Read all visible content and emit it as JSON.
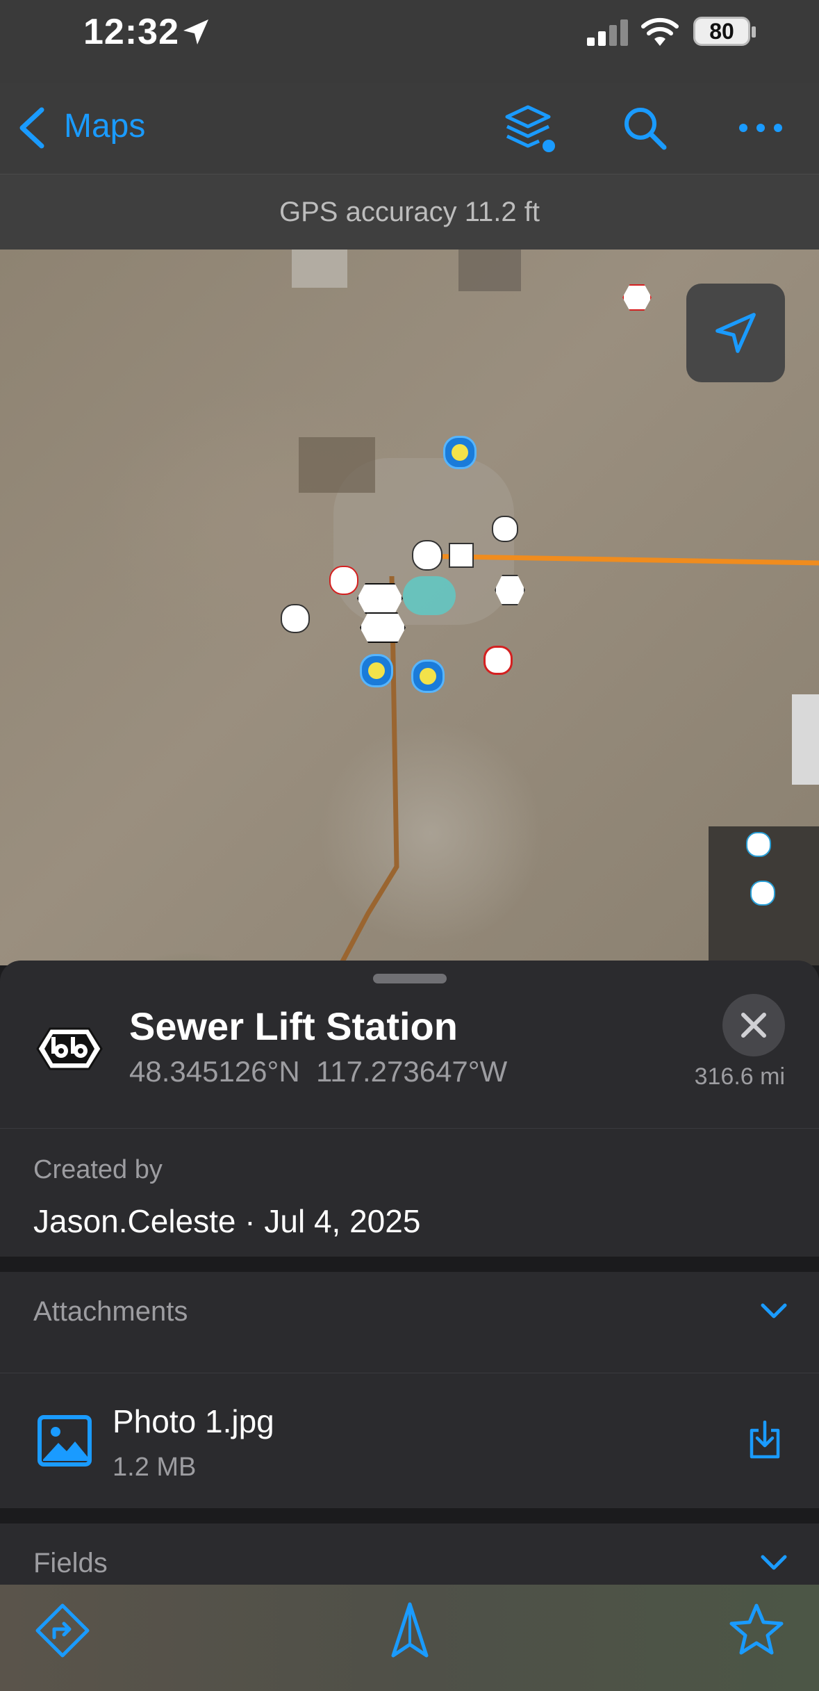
{
  "status_bar": {
    "time": "12:32",
    "battery": "80"
  },
  "nav": {
    "back_label": "Maps"
  },
  "gps": {
    "accuracy_text": "GPS accuracy 11.2 ft"
  },
  "feature": {
    "title": "Sewer Lift Station",
    "latitude": "48.345126°N",
    "longitude": "117.273647°W",
    "distance": "316.6 mi"
  },
  "created": {
    "label": "Created by",
    "value": "Jason.Celeste · Jul 4, 2025"
  },
  "attachments": {
    "label": "Attachments",
    "items": [
      {
        "name": "Photo 1.jpg",
        "size": "1.2 MB"
      }
    ]
  },
  "fields": {
    "label": "Fields"
  },
  "colors": {
    "accent": "#1a9bff",
    "sheet_bg": "#2b2b2e",
    "line_orange": "#f08c1e",
    "line_brown": "#9a6530"
  },
  "icons": {
    "status": [
      "location-arrow-icon",
      "signal-icon",
      "wifi-icon",
      "battery-icon"
    ],
    "nav": [
      "chevron-left-icon",
      "layers-icon",
      "search-icon",
      "more-icon"
    ],
    "map": [
      "recenter-arrow-icon"
    ],
    "toolbar": [
      "directions-icon",
      "compass-icon",
      "star-icon"
    ]
  }
}
